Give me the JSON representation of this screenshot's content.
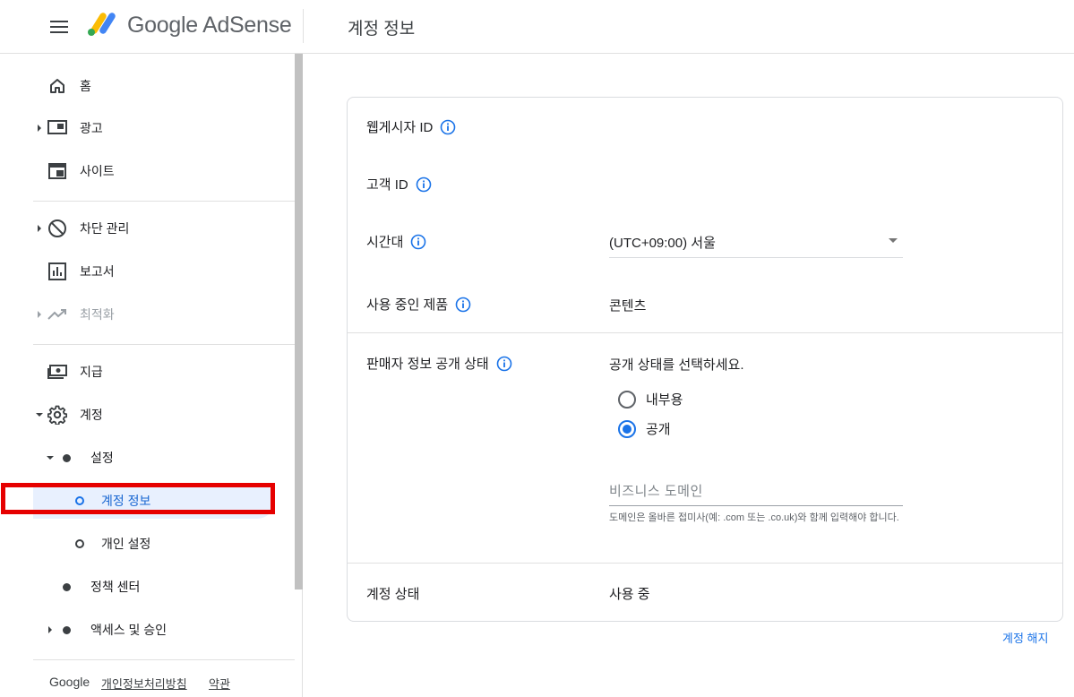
{
  "header": {
    "brand": "Google AdSense",
    "page_title": "계정 정보"
  },
  "sidebar": {
    "items": {
      "home": "홈",
      "ads": "광고",
      "sites": "사이트",
      "blocking": "차단 관리",
      "reports": "보고서",
      "optimization": "최적화",
      "payments": "지급",
      "account": "계정",
      "settings": "설정",
      "account_info": "계정 정보",
      "personal_settings": "개인 설정",
      "policy_center": "정책 센터",
      "access": "액세스 및 승인"
    },
    "footer": {
      "google": "Google",
      "privacy": "개인정보처리방침",
      "terms": "약관"
    }
  },
  "card": {
    "publisher_id_label": "웹게시자 ID",
    "customer_id_label": "고객 ID",
    "timezone_label": "시간대",
    "timezone_value": "(UTC+09:00) 서울",
    "products_label": "사용 중인 제품",
    "products_value": "콘텐츠",
    "seller_label": "판매자 정보 공개 상태",
    "seller_prompt": "공개 상태를 선택하세요.",
    "radio_internal": "내부용",
    "radio_public": "공개",
    "domain_placeholder": "비즈니스 도메인",
    "domain_hint": "도메인은 올바른 접미사(예: .com 또는 .co.uk)와 함께 입력해야 합니다.",
    "status_label": "계정 상태",
    "status_value": "사용 중"
  },
  "close_account": "계정 해지",
  "colors": {
    "accent": "#1a73e8",
    "highlight": "#e60000",
    "active_bg": "#e8f0fe"
  }
}
